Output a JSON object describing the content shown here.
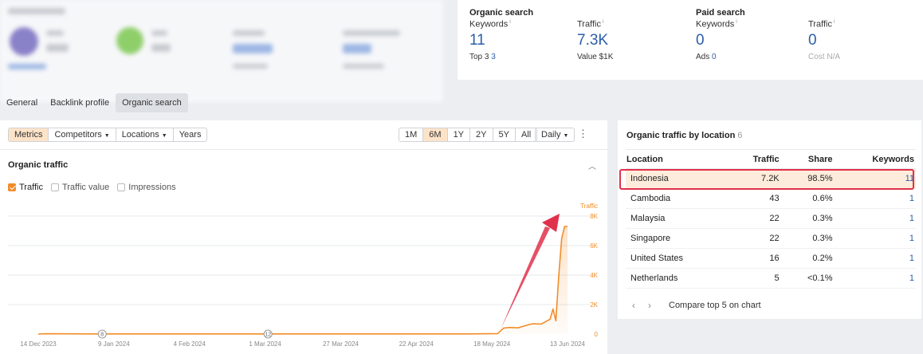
{
  "organic_search": {
    "heading": "Organic search",
    "keywords": {
      "label": "Keywords",
      "info": "i",
      "value": "11",
      "sub_label": "Top 3",
      "sub_value": "3"
    },
    "traffic": {
      "label": "Traffic",
      "info": "i",
      "value": "7.3K",
      "sub_label": "Value",
      "sub_value": "$1K"
    }
  },
  "paid_search": {
    "heading": "Paid search",
    "keywords": {
      "label": "Keywords",
      "info": "i",
      "value": "0",
      "sub_label": "Ads",
      "sub_value": "0"
    },
    "traffic": {
      "label": "Traffic",
      "info": "i",
      "value": "0",
      "sub_label": "Cost",
      "sub_value": "N/A"
    }
  },
  "tabs": [
    "General",
    "Backlink profile",
    "Organic search"
  ],
  "active_tab": "Organic search",
  "toolbar": {
    "filters": [
      "Metrics",
      "Competitors",
      "Locations",
      "Years"
    ],
    "ranges": [
      "1M",
      "6M",
      "1Y",
      "2Y",
      "5Y",
      "All"
    ],
    "active_range": "6M",
    "granularity": "Daily"
  },
  "panel": {
    "title": "Organic traffic",
    "legend": [
      {
        "label": "Traffic",
        "checked": true
      },
      {
        "label": "Traffic value",
        "checked": false
      },
      {
        "label": "Impressions",
        "checked": false
      }
    ]
  },
  "colors": {
    "accent": "#f28c28",
    "link": "#2b5ea8",
    "highlight_border": "#e0314c",
    "arrow": "#e0314c"
  },
  "chart_data": {
    "type": "line",
    "series": [
      {
        "name": "Traffic",
        "points": [
          [
            "2023-12-14",
            0
          ],
          [
            "2023-12-17",
            20
          ],
          [
            "2024-01-01",
            10
          ],
          [
            "2024-02-01",
            10
          ],
          [
            "2024-03-01",
            10
          ],
          [
            "2024-04-01",
            10
          ],
          [
            "2024-05-10",
            10
          ],
          [
            "2024-05-20",
            30
          ],
          [
            "2024-05-22",
            400
          ],
          [
            "2024-05-24",
            450
          ],
          [
            "2024-05-27",
            420
          ],
          [
            "2024-05-30",
            600
          ],
          [
            "2024-06-01",
            700
          ],
          [
            "2024-06-04",
            680
          ],
          [
            "2024-06-06",
            900
          ],
          [
            "2024-06-07",
            1000
          ],
          [
            "2024-06-08",
            1700
          ],
          [
            "2024-06-09",
            900
          ],
          [
            "2024-06-10",
            4000
          ],
          [
            "2024-06-11",
            6500
          ],
          [
            "2024-06-12",
            7300
          ],
          [
            "2024-06-13",
            7300
          ]
        ]
      }
    ],
    "x_ticks": [
      "14 Dec 2023",
      "9 Jan 2024",
      "4 Feb 2024",
      "1 Mar 2024",
      "27 Mar 2024",
      "22 Apr 2024",
      "18 May 2024",
      "13 Jun 2024"
    ],
    "x_tick_dates": [
      "2023-12-14",
      "2024-01-09",
      "2024-02-04",
      "2024-03-01",
      "2024-03-27",
      "2024-04-22",
      "2024-05-18",
      "2024-06-13"
    ],
    "y_ticks": [
      "0",
      "2K",
      "4K",
      "6K",
      "8K"
    ],
    "y_tick_values": [
      0,
      2000,
      4000,
      6000,
      8000
    ],
    "ylim": [
      0,
      8000
    ],
    "ylabel": "Traffic",
    "annotations": [
      {
        "date": "2024-01-05",
        "label": "8"
      },
      {
        "date": "2024-03-02",
        "label": "12"
      }
    ],
    "grid": true
  },
  "locations": {
    "title": "Organic traffic by location",
    "count": "6",
    "columns": [
      "Location",
      "Traffic",
      "Share",
      "Keywords"
    ],
    "rows": [
      [
        "Indonesia",
        "7.2K",
        "98.5%",
        "11"
      ],
      [
        "Cambodia",
        "43",
        "0.6%",
        "1"
      ],
      [
        "Malaysia",
        "22",
        "0.3%",
        "1"
      ],
      [
        "Singapore",
        "22",
        "0.3%",
        "1"
      ],
      [
        "United States",
        "16",
        "0.2%",
        "1"
      ],
      [
        "Netherlands",
        "5",
        "<0.1%",
        "1"
      ]
    ],
    "highlighted_row": 0,
    "pager": {
      "prev": "‹",
      "next": "›",
      "compare": "Compare top 5 on chart"
    }
  }
}
